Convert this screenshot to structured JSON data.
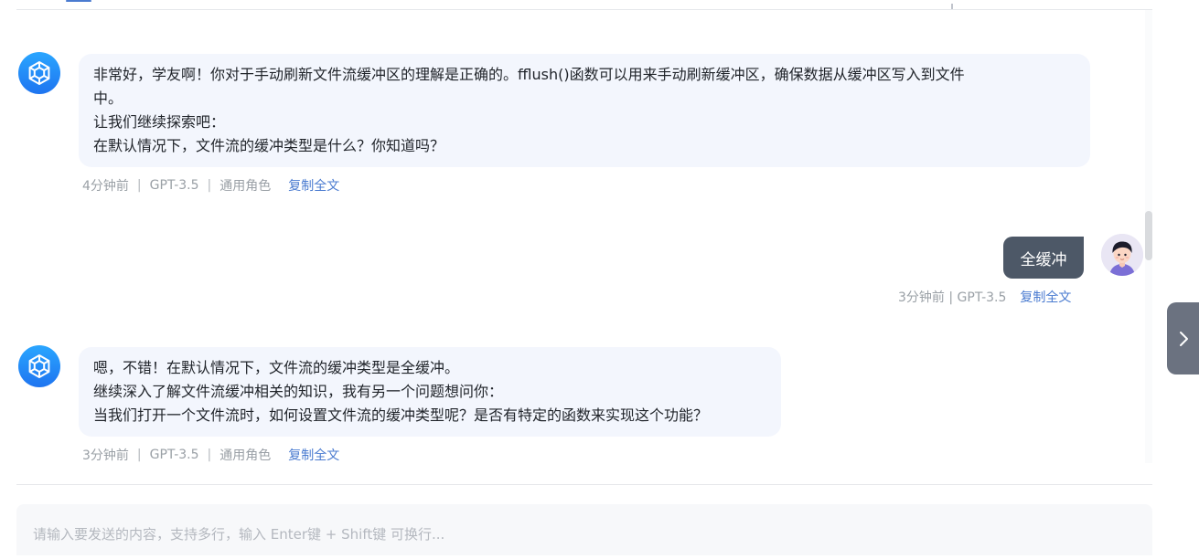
{
  "messages": [
    {
      "role": "assistant",
      "lines": [
        "非常好，学友啊！你对于手动刷新文件流缓冲区的理解是正确的。fflush()函数可以用来手动刷新缓冲区，确保数据从缓冲区写入到文件",
        "中。",
        "让我们继续探索吧：",
        "在默认情况下，文件流的缓冲类型是什么？你知道吗？"
      ],
      "time": "4分钟前",
      "model": "GPT-3.5",
      "role_name": "通用角色",
      "copy_label": "复制全文",
      "avatar_icon": "openai-logo-icon"
    },
    {
      "role": "user",
      "text": "全缓冲",
      "meta": "3分钟前 | GPT-3.5",
      "copy_label": "复制全文",
      "avatar_icon": "user-avatar-icon"
    },
    {
      "role": "assistant",
      "lines": [
        "嗯，不错！在默认情况下，文件流的缓冲类型是全缓冲。",
        "继续深入了解文件流缓冲相关的知识，我有另一个问题想问你：",
        "当我们打开一个文件流时，如何设置文件流的缓冲类型呢？是否有特定的函数来实现这个功能？"
      ],
      "time": "3分钟前",
      "model": "GPT-3.5",
      "role_name": "通用角色",
      "copy_label": "复制全文",
      "avatar_icon": "openai-logo-icon"
    }
  ],
  "meta_separator": "|",
  "input": {
    "placeholder": "请输入要发送的内容，支持多行，输入 Enter键 + Shift键 可换行...",
    "value": ""
  },
  "side_toggle_icon": "chevron-right-icon",
  "colors": {
    "bot_bubble": "#f3f6fd",
    "user_bubble": "#4d5867",
    "link": "#4a7bd0",
    "meta_text": "#9aa0a6",
    "bot_avatar": "#1e90ff"
  }
}
